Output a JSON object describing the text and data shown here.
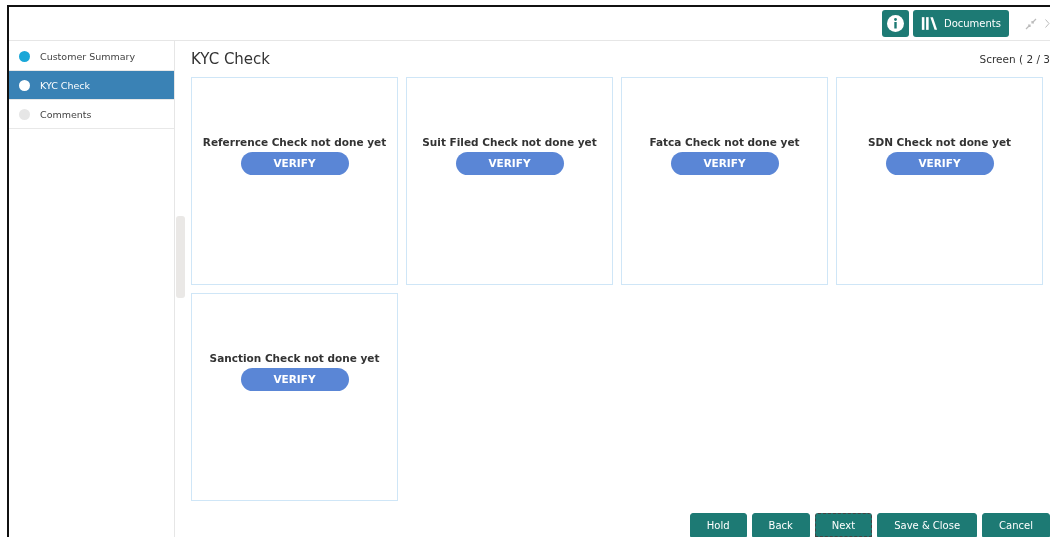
{
  "header": {
    "info_button": {
      "kind": "info"
    },
    "documents_button": {
      "label": "Documents"
    }
  },
  "steps": [
    {
      "label": "Customer Summary",
      "selected": false,
      "kind": "done"
    },
    {
      "label": "KYC Check",
      "selected": true,
      "kind": "current"
    },
    {
      "label": "Comments",
      "selected": false,
      "kind": "pending"
    }
  ],
  "page": {
    "title": "KYC Check",
    "screen_counter": "Screen ( 2 / 3"
  },
  "checks": [
    {
      "message": "Referrence Check not done yet",
      "button": "VERIFY"
    },
    {
      "message": "Suit Filed Check not done yet",
      "button": "VERIFY"
    },
    {
      "message": "Fatca Check not done yet",
      "button": "VERIFY"
    },
    {
      "message": "SDN Check not done yet",
      "button": "VERIFY"
    },
    {
      "message": "Sanction Check not done yet",
      "button": "VERIFY"
    }
  ],
  "footer_buttons": [
    {
      "label": "Hold",
      "focused": false
    },
    {
      "label": "Back",
      "focused": false
    },
    {
      "label": "Next",
      "focused": true
    },
    {
      "label": "Save & Close",
      "focused": false
    },
    {
      "label": "Cancel",
      "focused": false
    }
  ]
}
